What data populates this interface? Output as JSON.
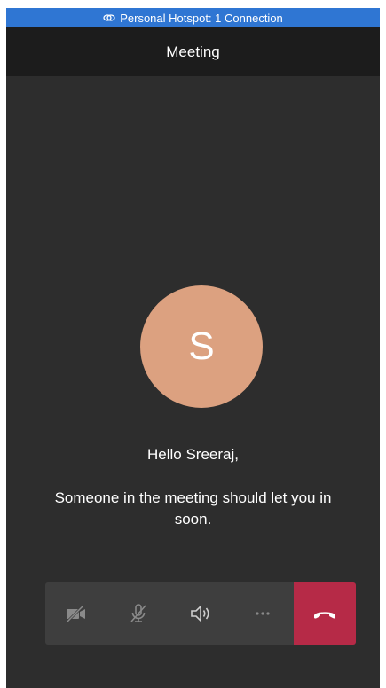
{
  "status_bar": {
    "hotspot_text": "Personal Hotspot: 1 Connection",
    "icon": "link-icon",
    "color": "#2f76d3"
  },
  "header": {
    "title": "Meeting"
  },
  "lobby": {
    "avatar_initial": "S",
    "avatar_color": "#dca180",
    "greeting": "Hello Sreeraj,",
    "message": "Someone in the meeting should let you in soon."
  },
  "toolbar": {
    "buttons": [
      {
        "id": "camera",
        "icon": "camera-off-icon"
      },
      {
        "id": "microphone",
        "icon": "mic-off-icon"
      },
      {
        "id": "speaker",
        "icon": "speaker-icon"
      },
      {
        "id": "more",
        "icon": "more-icon"
      }
    ],
    "hangup": {
      "icon": "hangup-icon",
      "color": "#b62a47"
    }
  }
}
